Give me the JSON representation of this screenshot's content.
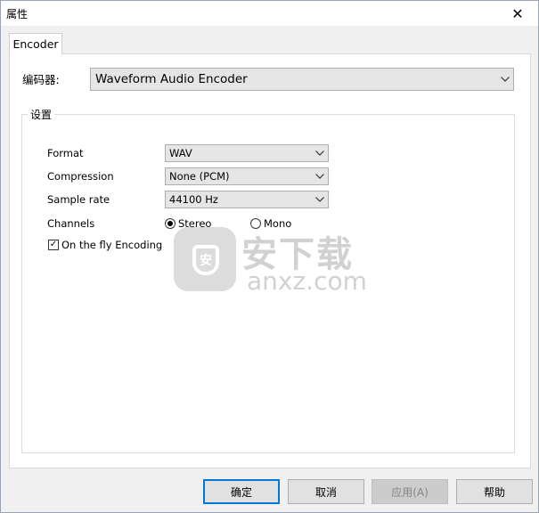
{
  "window": {
    "title": "属性",
    "close_glyph": "✕"
  },
  "tabs": [
    {
      "label": "Encoder"
    }
  ],
  "encoder": {
    "label": "编码器:",
    "selected": "Waveform Audio Encoder"
  },
  "settings": {
    "group_label": "设置",
    "format": {
      "label": "Format",
      "selected": "WAV"
    },
    "compression": {
      "label": "Compression",
      "selected": "None (PCM)"
    },
    "sample_rate": {
      "label": "Sample rate",
      "selected": "44100 Hz"
    },
    "channels": {
      "label": "Channels",
      "options": [
        {
          "label": "Stereo",
          "selected": true
        },
        {
          "label": "Mono",
          "selected": false
        }
      ]
    },
    "on_the_fly": {
      "label": "On the fly Encoding",
      "checked": true,
      "check_glyph": "✓"
    }
  },
  "watermark": {
    "text_cn": "安下载",
    "text_en": "anxz.com",
    "shield_glyph": "安"
  },
  "buttons": {
    "ok": "确定",
    "cancel": "取消",
    "apply": "应用(A)",
    "help": "帮助"
  },
  "icons": {
    "chevron": "chevron-down-icon",
    "close": "close-icon",
    "check": "check-icon"
  }
}
